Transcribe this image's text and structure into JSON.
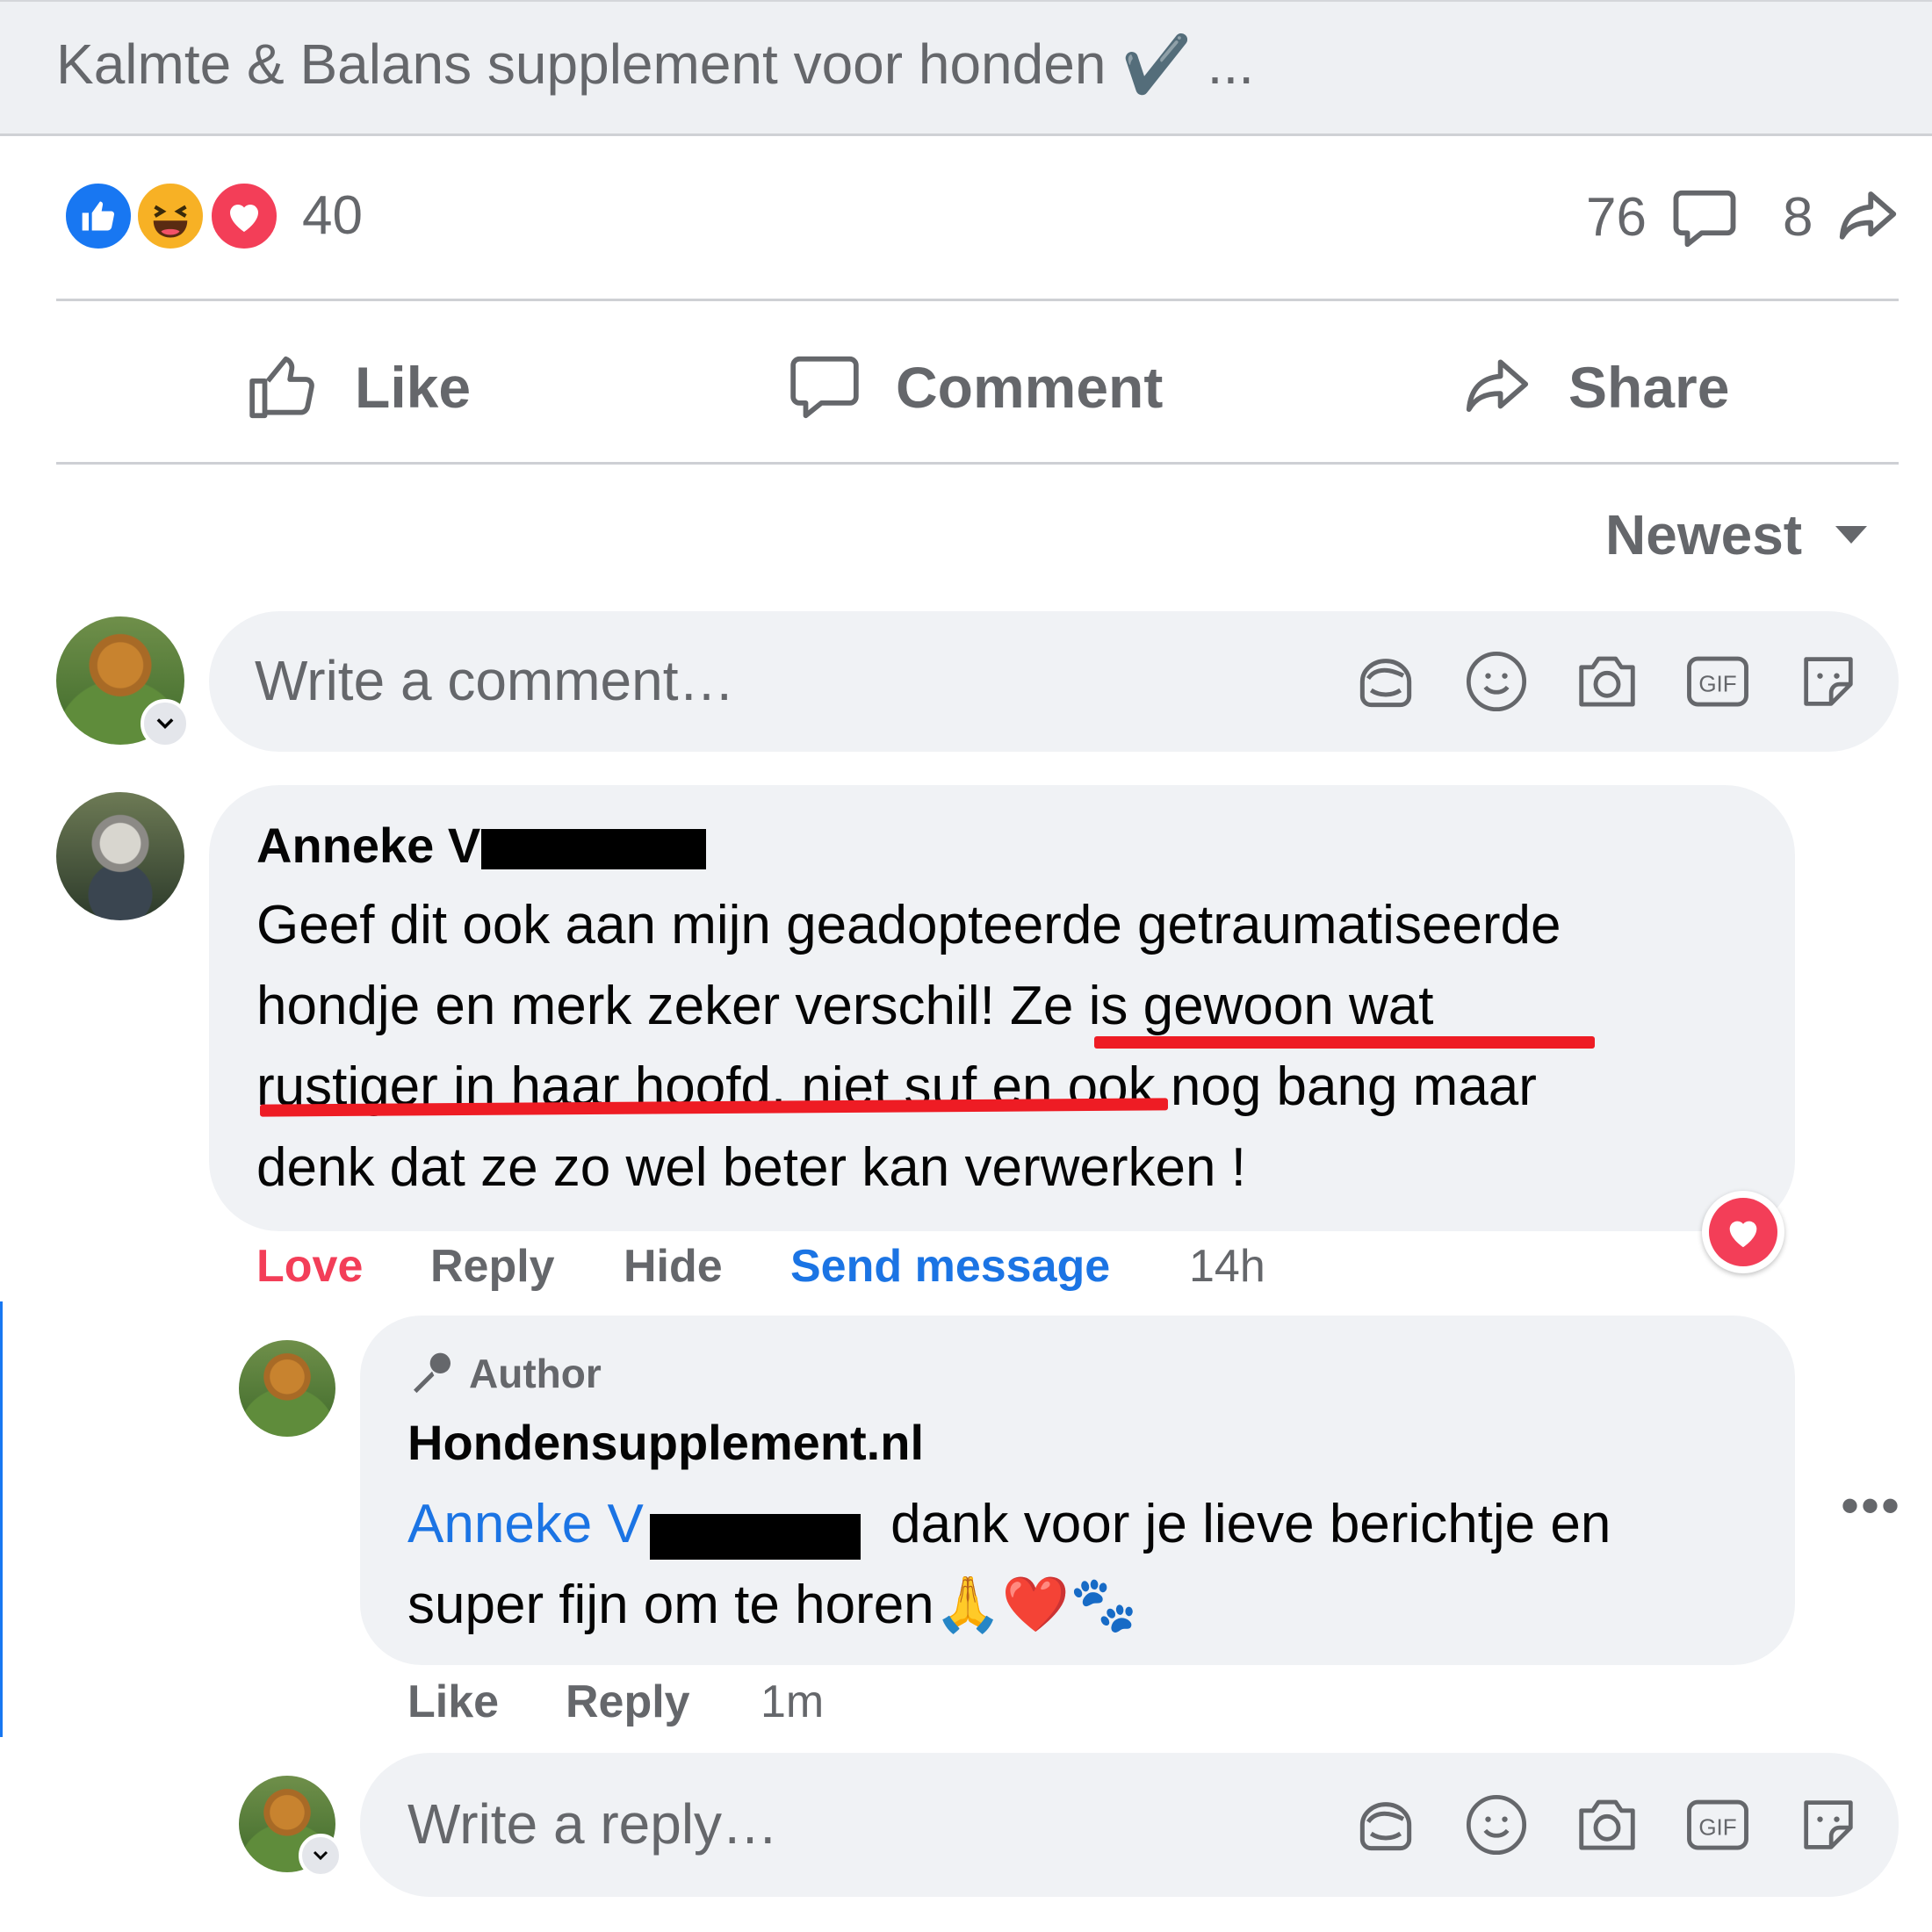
{
  "post": {
    "preview_text": "Kalmte & Balans supplement voor honden ✔️ ...",
    "reaction_count": "40",
    "comment_count": "76",
    "share_count": "8"
  },
  "actions": {
    "like": "Like",
    "comment": "Comment",
    "share": "Share"
  },
  "sort": {
    "label": "Newest"
  },
  "composer": {
    "placeholder": "Write a comment…"
  },
  "comment": {
    "author_visible": "Anneke V",
    "lines": [
      "Geef dit ook aan mijn geadopteerde getraumatiseerde",
      "hondje en merk zeker verschil! Ze is gewoon wat",
      "rustiger in haar hoofd, niet suf en ook nog bang maar",
      "denk dat ze zo wel beter kan verwerken !"
    ],
    "actions": {
      "reaction": "Love",
      "reply": "Reply",
      "hide": "Hide",
      "send": "Send message",
      "time": "14h"
    }
  },
  "reply": {
    "badge": "Author",
    "author": "Hondensupplement.nl",
    "mention": "Anneke V",
    "line1_rest": "dank voor je lieve berichtje en",
    "line2": "super fijn om te horen🙏❤️🐾",
    "actions": {
      "like": "Like",
      "reply": "Reply",
      "time": "1m"
    }
  },
  "reply_composer": {
    "placeholder": "Write a reply…"
  },
  "colors": {
    "like_blue": "#1877f2",
    "love_red": "#f33e58",
    "link_blue": "#1b74e4",
    "annotation_red": "#ee1c24"
  }
}
